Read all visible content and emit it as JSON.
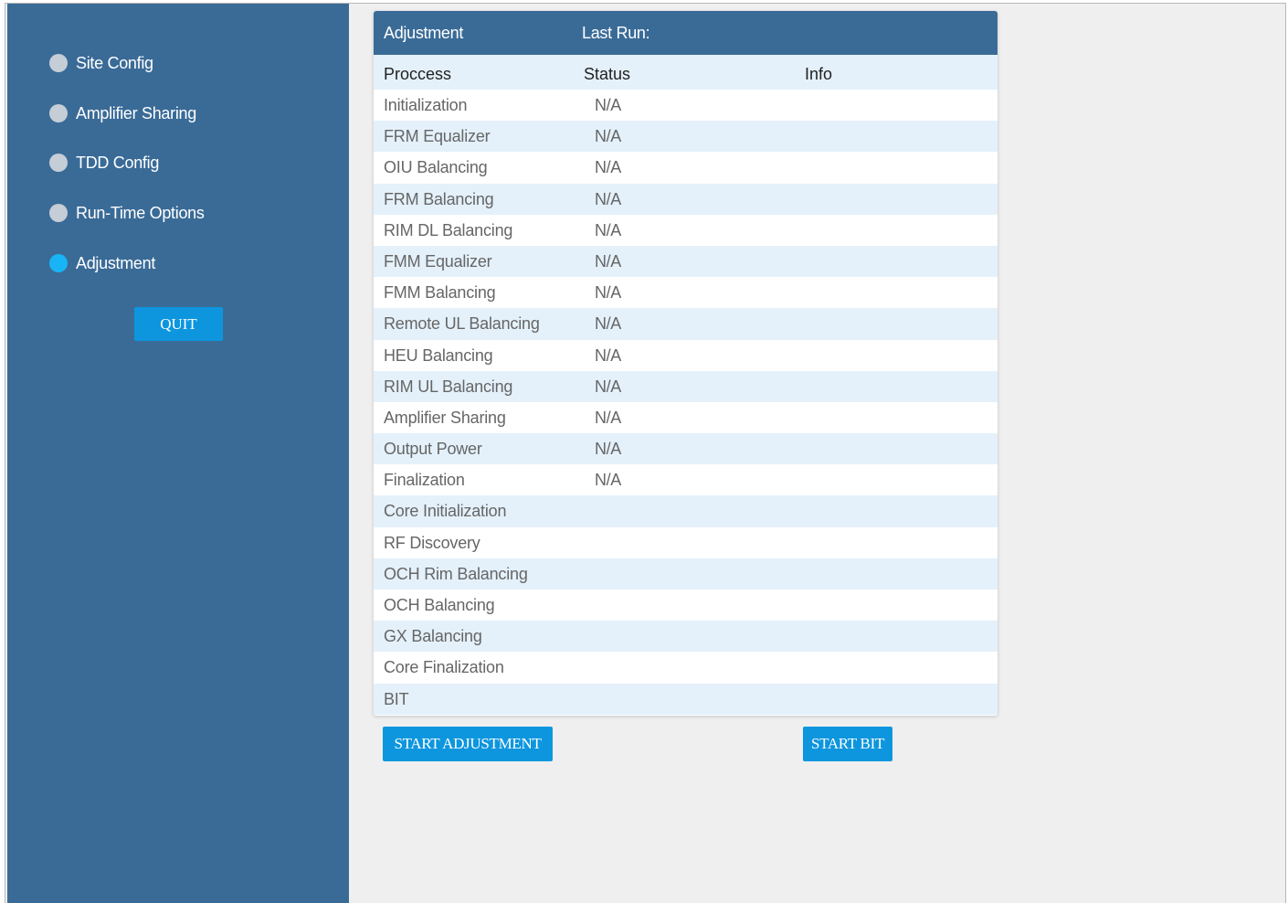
{
  "sidebar": {
    "items": [
      {
        "label": "Site Config",
        "active": false
      },
      {
        "label": "Amplifier Sharing",
        "active": false
      },
      {
        "label": "TDD Config",
        "active": false
      },
      {
        "label": "Run-Time Options",
        "active": false
      },
      {
        "label": "Adjustment",
        "active": true
      }
    ],
    "quit_label": "QUIT"
  },
  "panel": {
    "title": "Adjustment",
    "last_run_label": "Last Run:",
    "columns": {
      "process": "Proccess",
      "status": "Status",
      "info": "Info"
    },
    "rows": [
      {
        "process": "Initialization",
        "status": "N/A",
        "info": ""
      },
      {
        "process": "FRM Equalizer",
        "status": "N/A",
        "info": ""
      },
      {
        "process": "OIU Balancing",
        "status": "N/A",
        "info": ""
      },
      {
        "process": "FRM Balancing",
        "status": "N/A",
        "info": ""
      },
      {
        "process": "RIM DL Balancing",
        "status": "N/A",
        "info": ""
      },
      {
        "process": "FMM Equalizer",
        "status": "N/A",
        "info": ""
      },
      {
        "process": "FMM Balancing",
        "status": "N/A",
        "info": ""
      },
      {
        "process": "Remote UL Balancing",
        "status": "N/A",
        "info": ""
      },
      {
        "process": "HEU Balancing",
        "status": "N/A",
        "info": ""
      },
      {
        "process": "RIM UL Balancing",
        "status": "N/A",
        "info": ""
      },
      {
        "process": "Amplifier Sharing",
        "status": "N/A",
        "info": ""
      },
      {
        "process": "Output Power",
        "status": "N/A",
        "info": ""
      },
      {
        "process": "Finalization",
        "status": "N/A",
        "info": ""
      },
      {
        "process": "Core Initialization",
        "status": "",
        "info": ""
      },
      {
        "process": "RF Discovery",
        "status": "",
        "info": ""
      },
      {
        "process": "OCH Rim Balancing",
        "status": "",
        "info": ""
      },
      {
        "process": "OCH Balancing",
        "status": "",
        "info": ""
      },
      {
        "process": "GX Balancing",
        "status": "",
        "info": ""
      },
      {
        "process": "Core Finalization",
        "status": "",
        "info": ""
      },
      {
        "process": "BIT",
        "status": "",
        "info": ""
      }
    ]
  },
  "actions": {
    "start_adjustment_label": "START ADJUSTMENT",
    "start_bit_label": "START BIT"
  },
  "colors": {
    "sidebar_bg": "#3a6b97",
    "accent": "#0d96de",
    "active_dot": "#19b4f5",
    "inactive_dot": "#c5cdd6",
    "row_alt": "#e4f1fb"
  }
}
